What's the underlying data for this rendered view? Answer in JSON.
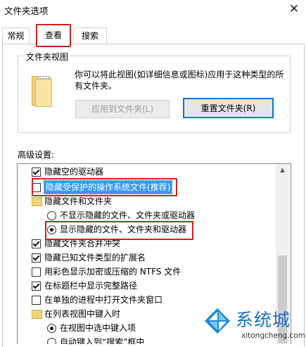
{
  "window": {
    "title": "文件夹选项",
    "close_glyph": "✕"
  },
  "tabs": [
    {
      "label": "常规"
    },
    {
      "label": "查看"
    },
    {
      "label": "搜索"
    }
  ],
  "folder_views": {
    "legend": "文件夹视图",
    "description": "你可以将此视图(如详细信息或图标)应用于这种类型的所有文件夹。",
    "apply_button": "应用到文件夹(L)",
    "reset_button": "重置文件夹(R)"
  },
  "advanced": {
    "label": "高级设置:",
    "items": [
      {
        "type": "checkbox",
        "checked": true,
        "label": "隐藏空的驱动器"
      },
      {
        "type": "checkbox",
        "checked": false,
        "label": "隐藏受保护的操作系统文件(推荐)"
      },
      {
        "type": "folder",
        "label": "隐藏文件和文件夹"
      },
      {
        "type": "radio",
        "checked": false,
        "label": "不显示隐藏的文件、文件夹或驱动器"
      },
      {
        "type": "radio",
        "checked": true,
        "label": "显示隐藏的文件、文件夹和驱动器"
      },
      {
        "type": "checkbox",
        "checked": true,
        "label": "隐藏文件夹合并冲突"
      },
      {
        "type": "checkbox",
        "checked": true,
        "label": "隐藏已知文件类型的扩展名"
      },
      {
        "type": "checkbox",
        "checked": false,
        "label": "用彩色显示加密或压缩的 NTFS 文件"
      },
      {
        "type": "checkbox",
        "checked": true,
        "label": "在标题栏中显示完整路径"
      },
      {
        "type": "checkbox",
        "checked": false,
        "label": "在单独的进程中打开文件夹窗口"
      },
      {
        "type": "folder",
        "label": "在列表视图中键入时"
      },
      {
        "type": "radio",
        "checked": true,
        "label": "在视图中选中键入项"
      },
      {
        "type": "radio",
        "checked": false,
        "label": "自动键入到“搜索”框中"
      }
    ]
  },
  "watermark": {
    "brand": "系统城",
    "url": "xitongcheng.com"
  },
  "colors": {
    "highlight_red": "#d02020",
    "selection_blue": "#3399ff",
    "brand_blue": "#1b6fc5"
  }
}
